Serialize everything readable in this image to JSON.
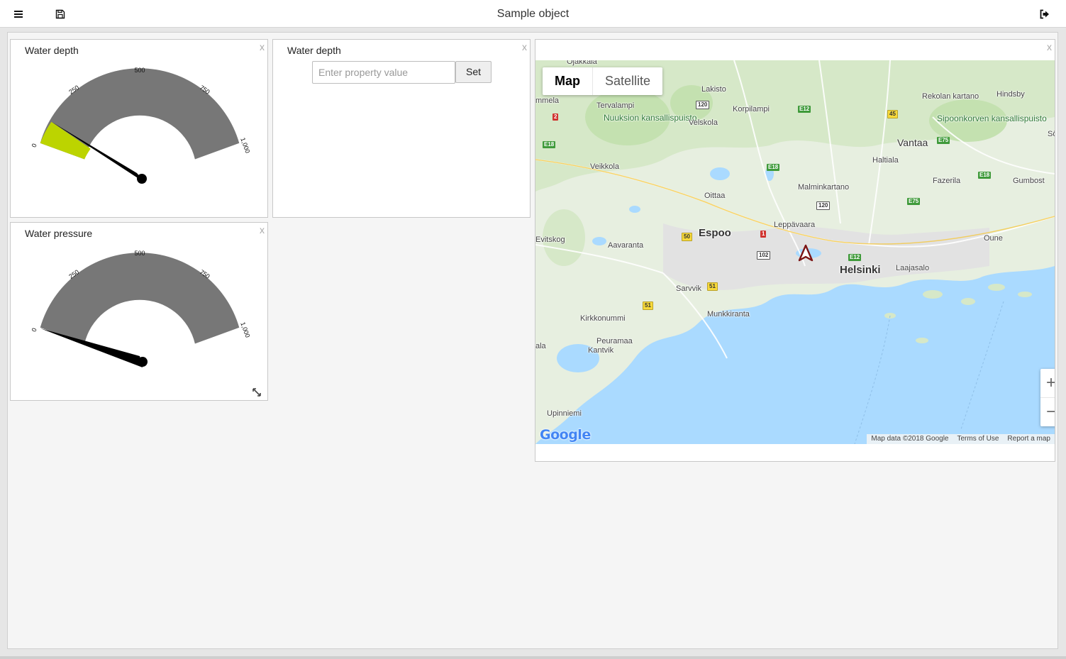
{
  "header": {
    "title": "Sample object",
    "menu_icon": "hamburger-menu-icon",
    "save_icon": "save-floppy-icon",
    "logout_icon": "logout-icon"
  },
  "widgets": {
    "water_depth_gauge": {
      "title": "Water depth",
      "close": "x",
      "scale": {
        "min": 0,
        "max": 1000,
        "ticks": [
          "0",
          "250",
          "500",
          "750",
          "1,000"
        ]
      },
      "value": 80,
      "colors": {
        "track": "#777777",
        "fill": "#bcd400",
        "needle": "#000000"
      }
    },
    "water_depth_input": {
      "title": "Water depth",
      "close": "x",
      "placeholder": "Enter property value",
      "button": "Set"
    },
    "water_pressure_gauge": {
      "title": "Water pressure",
      "close": "x",
      "scale": {
        "min": 0,
        "max": 1000,
        "ticks": [
          "0",
          "250",
          "500",
          "750",
          "1,000"
        ]
      },
      "value": 0,
      "resize_icon": "resize-diagonal-icon"
    },
    "map": {
      "close": "x",
      "type_buttons": {
        "map": "Map",
        "satellite": "Satellite"
      },
      "zoom": {
        "in": "+",
        "out": "−"
      },
      "attribution": {
        "data": "Map data ©2018 Google",
        "terms": "Terms of Use",
        "report": "Report a map"
      },
      "logo": "Google",
      "marker_icon": "navigation-arrow-icon",
      "places": {
        "ojakkala": "Ojakkala",
        "lakisto": "Lakisto",
        "rekolan": "Rekolan kartano",
        "hindsby": "Hindsby",
        "mmela": "mmela",
        "tervalampi": "Tervalampi",
        "nuuksion": "Nuuksion kansallispuisto",
        "korpilampi": "Korpilampi",
        "sipoonkorven": "Sipoonkorven kansallispuisto",
        "velskola": "Velskola",
        "vantaa": "Vantaa",
        "so": "Sö",
        "haltiala": "Haltiala",
        "veikkola": "Veikkola",
        "fazerila": "Fazerila",
        "gumbost": "Gumbost",
        "malminkartano": "Malminkartano",
        "oittaa": "Oittaa",
        "leppavaara": "Leppävaara",
        "espoo": "Espoo",
        "evitskog": "Evitskog",
        "aavaranta": "Aavaranta",
        "helsinki": "Helsinki",
        "laajasalo": "Laajasalo",
        "sarvvik": "Sarvvik",
        "munkkiranta": "Munkkiranta",
        "kirkkonummi": "Kirkkonummi",
        "peuramaa": "Peuramaa",
        "ala": "ala",
        "kantvik": "Kantvik",
        "upinniemi": "Upinniemi",
        "oune": "Oune"
      },
      "shields": {
        "e18a": "E18",
        "e18b": "E18",
        "e18c": "E18",
        "e12a": "E12",
        "e12b": "E12",
        "e75a": "E75",
        "e75b": "E75",
        "r120a": "120",
        "r120b": "120",
        "r102": "102",
        "r45": "45",
        "r50": "50",
        "r51a": "51",
        "r51b": "51",
        "r1": "1",
        "r2": "2"
      }
    }
  }
}
